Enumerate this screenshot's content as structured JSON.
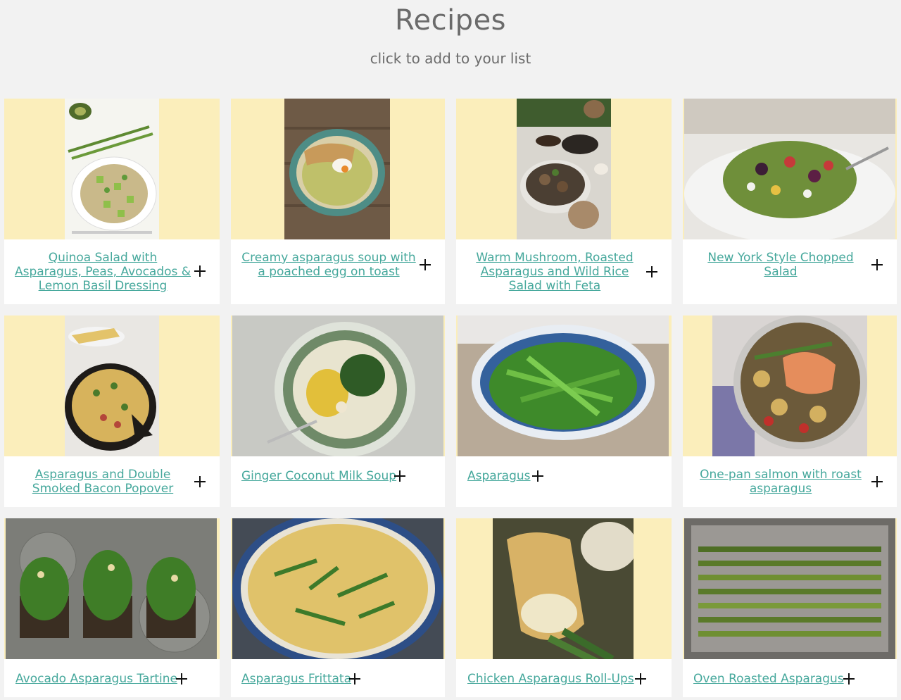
{
  "header": {
    "title": "Recipes",
    "subtitle": "click to add to your list"
  },
  "recipes": [
    {
      "title": "Quinoa Salad with Asparagus, Peas, Avocados & Lemon Basil Dressing",
      "image": "quinoa-salad-photo"
    },
    {
      "title": "Creamy asparagus soup with a poached egg on toast",
      "image": "asparagus-soup-photo"
    },
    {
      "title": "Warm Mushroom, Roasted Asparagus and Wild Rice Salad with Feta",
      "image": "mushroom-salad-photo"
    },
    {
      "title": "New York Style Chopped Salad",
      "image": "chopped-salad-photo"
    },
    {
      "title": "Asparagus and Double Smoked Bacon Popover",
      "image": "popover-photo"
    },
    {
      "title": "Ginger Coconut Milk Soup",
      "image": "coconut-soup-photo"
    },
    {
      "title": "Asparagus",
      "image": "asparagus-bowl-photo"
    },
    {
      "title": "One-pan salmon with roast asparagus",
      "image": "salmon-photo"
    },
    {
      "title": "Avocado Asparagus Tartine",
      "image": "tartine-photo"
    },
    {
      "title": "Asparagus Frittata",
      "image": "frittata-photo"
    },
    {
      "title": "Chicken Asparagus Roll-Ups",
      "image": "roll-ups-photo"
    },
    {
      "title": "Oven Roasted Asparagus",
      "image": "roasted-asparagus-photo"
    }
  ],
  "colors": {
    "background": "#f2f2f2",
    "card": "#ffffff",
    "image_placeholder": "#fbeebb",
    "link": "#46a89c",
    "title_text": "#6b6b6b"
  }
}
